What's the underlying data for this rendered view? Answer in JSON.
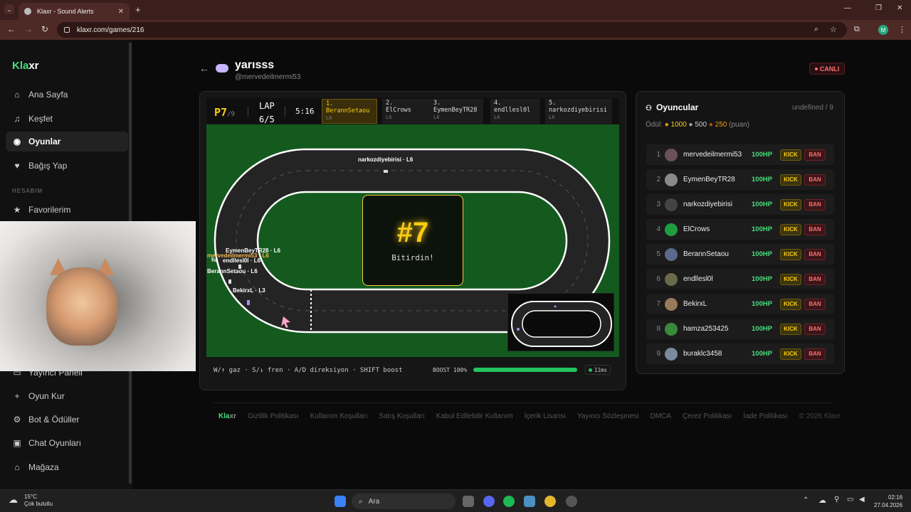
{
  "browser": {
    "tab_title": "Klaxr - Sound Alerts",
    "url": "klaxr.com/games/216",
    "profile_initial": "M"
  },
  "sidebar": {
    "logo_k": "Kla",
    "logo_rest": "xr",
    "items_top": [
      {
        "label": "Ana Sayfa",
        "icon": "home-icon"
      },
      {
        "label": "Keşfet",
        "icon": "music-icon"
      },
      {
        "label": "Oyunlar",
        "icon": "gamepad-icon"
      },
      {
        "label": "Bağış Yap",
        "icon": "heart-icon"
      }
    ],
    "section": "HESABIM",
    "items_account": [
      {
        "label": "Favorilerim",
        "icon": "star-icon"
      }
    ],
    "items_bottom": [
      {
        "label": "Yayıncı Paneli",
        "icon": "monitor-icon"
      },
      {
        "label": "Oyun Kur",
        "icon": "plus-icon"
      },
      {
        "label": "Bot & Ödüller",
        "icon": "robot-icon"
      },
      {
        "label": "Chat Oyunları",
        "icon": "chat-icon"
      },
      {
        "label": "Mağaza",
        "icon": "store-icon"
      }
    ]
  },
  "game": {
    "title": "yarısss",
    "owner": "@mervedeilmermi53",
    "live_label": "CANLI",
    "hud": {
      "position": "P7",
      "total": "/9",
      "lap_label": "LAP",
      "lap_value": "6/5",
      "time": "5:16"
    },
    "leaderboard": [
      {
        "rank": "1.",
        "name": "BerannSetaou",
        "lap": "L6"
      },
      {
        "rank": "2.",
        "name": "ElCrows",
        "lap": "L6"
      },
      {
        "rank": "3.",
        "name": "EymenBeyTR28",
        "lap": "L6"
      },
      {
        "rank": "4.",
        "name": "endllesl0l",
        "lap": "L6"
      },
      {
        "rank": "5.",
        "name": "narkozdiyebirisi",
        "lap": "L6"
      }
    ],
    "result": {
      "place": "#7",
      "message": "Bitirdin!"
    },
    "car_labels": [
      "narkozdiyebirisi · L6",
      "EymenBeyTR28 · L6",
      "mervedeilmermi53 · L6",
      "endllesl0l · L6",
      "ha",
      "BerannSetaou · L6",
      "BekirxL · L3"
    ],
    "controls_hint": "W/↑ gaz · S/↓ fren · A/D direksiyon · SHIFT boost",
    "boost_label": "BOOST 100%",
    "boost_level": 1.0,
    "ping": "11ms"
  },
  "players_panel": {
    "title": "Oyuncular",
    "count": "undefined / 9",
    "reward_label": "Ödül:",
    "reward_gold": "1000",
    "reward_silver": "500",
    "reward_bronze": "250",
    "reward_unit": "(puan)",
    "kick_label": "KICK",
    "ban_label": "BAN",
    "rows": [
      {
        "num": "1",
        "name": "mervedeilmermi53",
        "hp": "100HP"
      },
      {
        "num": "2",
        "name": "EymenBeyTR28",
        "hp": "100HP"
      },
      {
        "num": "3",
        "name": "narkozdiyebirisi",
        "hp": "100HP"
      },
      {
        "num": "4",
        "name": "ElCrows",
        "hp": "100HP"
      },
      {
        "num": "5",
        "name": "BerannSetaou",
        "hp": "100HP"
      },
      {
        "num": "6",
        "name": "endllesl0l",
        "hp": "100HP"
      },
      {
        "num": "7",
        "name": "BekirxL",
        "hp": "100HP"
      },
      {
        "num": "8",
        "name": "hamza253425",
        "hp": "100HP"
      },
      {
        "num": "9",
        "name": "buraklc3458",
        "hp": "100HP"
      }
    ]
  },
  "footer": {
    "logo_k": "Kla",
    "logo_rest": "xr",
    "links": [
      "Gizlilik Politikası",
      "Kullanım Koşulları",
      "Satış Koşulları",
      "Kabul Edilebilir Kullanım",
      "İçerik Lisansı",
      "Yayıncı Sözleşmesi",
      "DMCA",
      "Çerez Politikası",
      "İade Politikası"
    ],
    "copyright": "© 2026 Klaxr"
  },
  "taskbar": {
    "temp": "15°C",
    "weather": "Çok bulutlu",
    "search": "Ara",
    "time": "02:16",
    "date": "27.04.2026"
  },
  "colors": {
    "accent": "#4ade80",
    "gold": "#facc15",
    "danger": "#f87171",
    "track_grass": "#145a1e"
  }
}
